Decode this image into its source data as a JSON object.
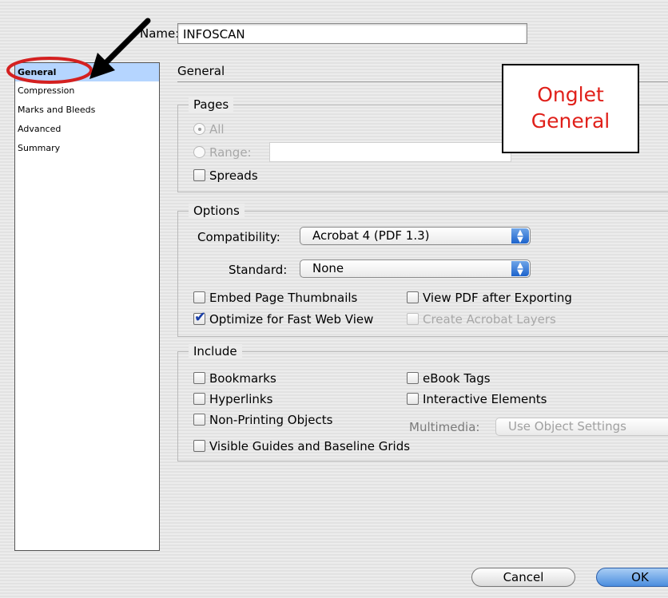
{
  "name_field": {
    "label": "Name:",
    "value": "INFOSCAN"
  },
  "sidebar": {
    "items": [
      {
        "label": "General",
        "selected": true
      },
      {
        "label": "Compression"
      },
      {
        "label": "Marks and Bleeds"
      },
      {
        "label": "Advanced"
      },
      {
        "label": "Summary"
      }
    ]
  },
  "panel": {
    "title": "General"
  },
  "pages": {
    "label": "Pages",
    "all_label": "All",
    "range_label": "Range:",
    "range_value": "",
    "spreads_label": "Spreads"
  },
  "options": {
    "label": "Options",
    "compatibility_label": "Compatibility:",
    "compatibility_value": "Acrobat 4 (PDF 1.3)",
    "standard_label": "Standard:",
    "standard_value": "None",
    "embed_thumbnails_label": "Embed Page Thumbnails",
    "view_pdf_label": "View PDF after Exporting",
    "optimize_label": "Optimize for Fast Web View",
    "acrobat_layers_label": "Create Acrobat Layers"
  },
  "include": {
    "label": "Include",
    "bookmarks_label": "Bookmarks",
    "hyperlinks_label": "Hyperlinks",
    "non_printing_label": "Non-Printing Objects",
    "visible_guides_label": "Visible Guides and Baseline Grids",
    "ebook_tags_label": "eBook Tags",
    "interactive_label": "Interactive Elements",
    "multimedia_label": "Multimedia:",
    "multimedia_value": "Use Object Settings"
  },
  "annotation": {
    "line1": "Onglet",
    "line2": "General",
    "color": "#e0201a"
  },
  "buttons": {
    "cancel": "Cancel",
    "ok": "OK"
  }
}
